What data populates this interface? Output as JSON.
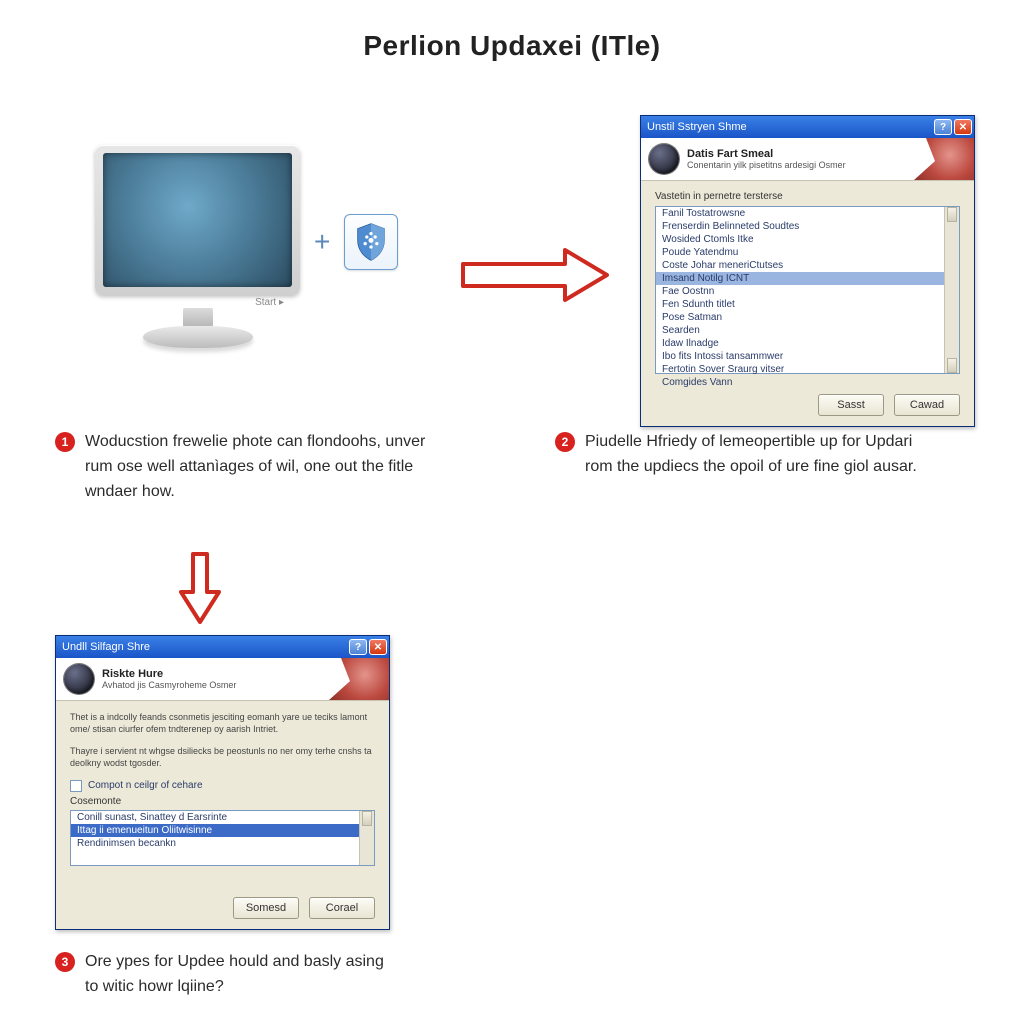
{
  "title": "Perlion Updaxei (ITle)",
  "steps": {
    "1": {
      "num": "1",
      "text": "Woducstion frewelie phote can flondoohs, unver rum ose well attanìages of wil, one out the fitle wndaer how."
    },
    "2": {
      "num": "2",
      "text": "Piudelle Hfriedy of lemeopertible up for Updari rom the updiecs the opoil of ure fine giol ausar."
    },
    "3": {
      "num": "3",
      "text": "Ore ypes for Updee hould and basly asing to witic howr lqiine?"
    }
  },
  "monitor_label": "Start ▸",
  "shield_icon_name": "shield-icon",
  "dialogA": {
    "titlebar": "Unstil Sstryen Shme",
    "header_title": "Datis Fart Smeal",
    "header_sub": "Conentarin yilk pisetitns ardesigi Osmer",
    "section_label": "Vastetin in pernetre tersterse",
    "items": [
      "Fanil Tostatrowsne",
      "Frenserdin Belinneted Soudtes",
      "Wosided Ctomls Itke",
      "Poude Yatendmu",
      "Coste Johar meneriCtutses",
      "Imsand Notilg ICNT",
      "Fae Oostnn",
      "Fen Sdunth titlet",
      "Pose Satman",
      "Searden",
      "Idaw Ilnadge",
      "Ibo fits Intossi tansammwer",
      "Fertotin Sover Sraurg vitser",
      "Comgides Vann"
    ],
    "selected_index": 5,
    "btn_ok": "Sasst",
    "btn_cancel": "Cawad"
  },
  "dialogB": {
    "titlebar": "Undll Silfagn Shre",
    "header_title": "Riskte Hure",
    "header_sub": "Avhatod jis Casmyroheme Osmer",
    "para1": "Thet is a indcolly feands csonmetis jesciting eomanh yare ue teciks lamont ome/ stisan ciurfer ofem tndterenep oy aarish Intriet.",
    "para2": "Thayre i servient nt whgse dsiliecks be peostunls no ner omy terhe cnshs ta deolkny wodst tgosder.",
    "checkbox_label": "Compot n ceilgr of cehare",
    "comments_label": "Cosemonte",
    "comments_items": [
      "Conill sunast, Sinattey d Earsrinte",
      "Ittag ii emenueitun Oliitwisinne",
      "Rendinimsen becankn"
    ],
    "comments_selected_index": 1,
    "btn_ok": "Somesd",
    "btn_cancel": "Corael"
  }
}
